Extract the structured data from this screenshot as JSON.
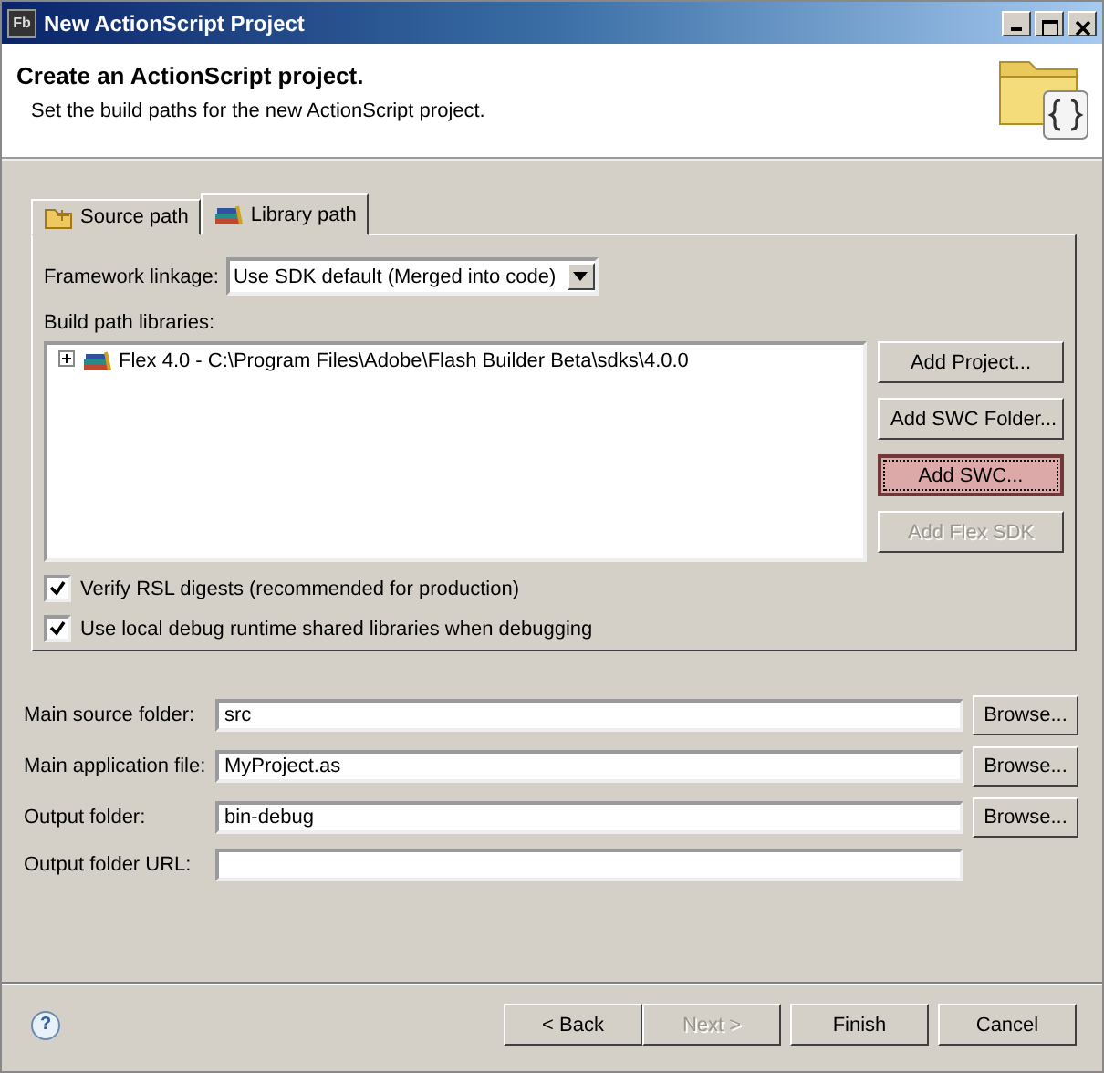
{
  "window": {
    "icon_text": "Fb",
    "title": "New ActionScript Project"
  },
  "header": {
    "title": "Create an ActionScript project.",
    "description": "Set the build paths for the new ActionScript project."
  },
  "tabs": [
    {
      "label": "Source path",
      "selected": false,
      "kind": "source"
    },
    {
      "label": "Library path",
      "selected": true,
      "kind": "library"
    }
  ],
  "framework_linkage": {
    "label": "Framework linkage:",
    "value": "Use SDK default (Merged into code)"
  },
  "libraries": {
    "label": "Build path libraries:",
    "items": [
      {
        "label": "Flex 4.0 - C:\\Program Files\\Adobe\\Flash Builder Beta\\sdks\\4.0.0",
        "expanded": false
      }
    ],
    "buttons": [
      {
        "label": "Add Project...",
        "disabled": false,
        "focused": false
      },
      {
        "label": "Add SWC Folder...",
        "disabled": false,
        "focused": false
      },
      {
        "label": "Add SWC...",
        "disabled": false,
        "focused": true
      },
      {
        "label": "Add Flex SDK",
        "disabled": true,
        "focused": false
      }
    ]
  },
  "options": [
    {
      "label": "Verify RSL digests (recommended for production)",
      "checked": true
    },
    {
      "label": "Use local debug runtime shared libraries when debugging",
      "checked": true
    }
  ],
  "fields": [
    {
      "label": "Main source folder:",
      "value": "src",
      "button": "Browse..."
    },
    {
      "label": "Main application file:",
      "value": "MyProject.as",
      "button": "Browse..."
    },
    {
      "label": "Output folder:",
      "value": "bin-debug",
      "button": "Browse..."
    },
    {
      "label": "Output folder URL:"
    }
  ],
  "footer": {
    "help": "?",
    "buttons": [
      {
        "label": "< Back",
        "disabled": false
      },
      {
        "label": "Next >",
        "disabled": true
      },
      {
        "label": "Finish",
        "disabled": false
      },
      {
        "label": "Cancel",
        "disabled": false
      }
    ]
  }
}
